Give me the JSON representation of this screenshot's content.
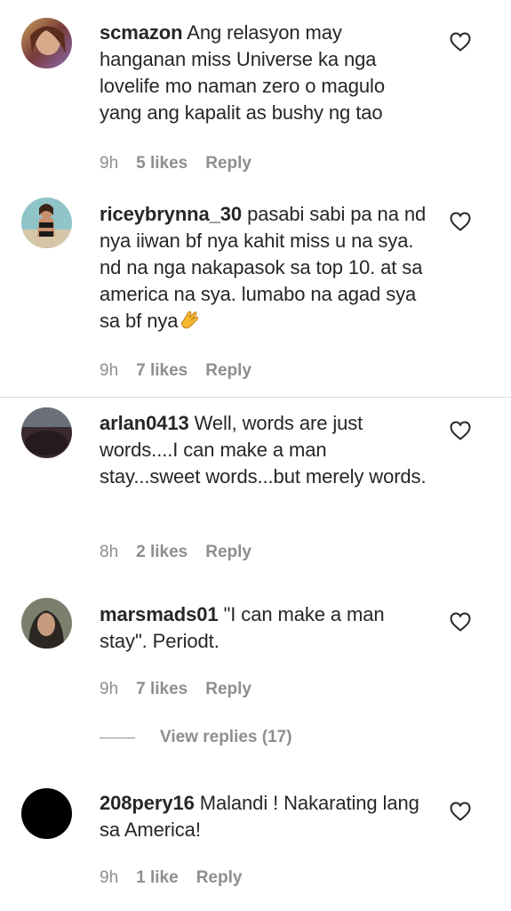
{
  "comments": [
    {
      "username": "scmazon",
      "text": "Ang relasyon may hanganan miss Universe ka nga lovelife mo naman zero o magulo yang ang kapalit as bushy ng tao",
      "time": "9h",
      "likes": "5 likes",
      "reply": "Reply"
    },
    {
      "username": "riceybrynna_30",
      "text": "pasabi sabi pa na nd nya iiwan bf nya kahit miss u na sya. nd na nga nakapasok sa top 10. at sa america na sya. lumabo na agad sya sa bf nya",
      "emoji": "clapping-hands-icon",
      "time": "9h",
      "likes": "7 likes",
      "reply": "Reply"
    },
    {
      "username": "arlan0413",
      "text": "Well, words are just words....I can make a man stay...sweet words...but merely words.",
      "time": "8h",
      "likes": "2 likes",
      "reply": "Reply"
    },
    {
      "username": "marsmads01",
      "text": "\"I can make a man stay\". Periodt.",
      "time": "9h",
      "likes": "7 likes",
      "reply": "Reply",
      "view_replies": "View replies (17)"
    },
    {
      "username": "208pery16",
      "text": "Malandi ! Nakarating lang sa America!",
      "time": "9h",
      "likes": "1 like",
      "reply": "Reply"
    }
  ],
  "colors": {
    "text": "#262626",
    "secondary": "#8e8e8e",
    "divider": "#dbdbdb"
  }
}
